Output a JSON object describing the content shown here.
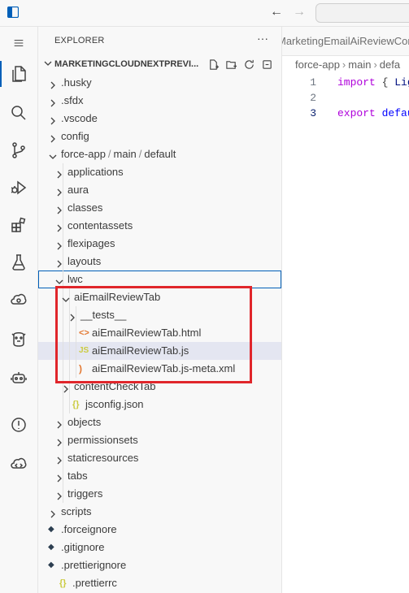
{
  "titlebar": {
    "nav_back": "←",
    "nav_forward": "→"
  },
  "activitybar": {
    "items": [
      "explorer-icon",
      "search-icon",
      "source-control-icon",
      "run-debug-icon",
      "extensions-icon",
      "testing-icon",
      "salesforce-org-icon",
      "agent-icon",
      "robot-icon",
      "info-icon",
      "salesforce-cloud-icon"
    ]
  },
  "explorer": {
    "title": "EXPLORER",
    "more": "···",
    "section_title": "MARKETINGCLOUDNEXTPREVI...",
    "tree": [
      {
        "label": ".husky",
        "type": "folder",
        "depth": 0
      },
      {
        "label": ".sfdx",
        "type": "folder",
        "depth": 0
      },
      {
        "label": ".vscode",
        "type": "folder",
        "depth": 0
      },
      {
        "label": "config",
        "type": "folder",
        "depth": 0
      },
      {
        "label": "force-app",
        "sep1": "/",
        "label2": "main",
        "sep2": "/",
        "label3": "default",
        "type": "folder-open",
        "depth": 0
      },
      {
        "label": "applications",
        "type": "folder",
        "depth": 1
      },
      {
        "label": "aura",
        "type": "folder",
        "depth": 1
      },
      {
        "label": "classes",
        "type": "folder",
        "depth": 1
      },
      {
        "label": "contentassets",
        "type": "folder",
        "depth": 1
      },
      {
        "label": "flexipages",
        "type": "folder",
        "depth": 1
      },
      {
        "label": "layouts",
        "type": "folder",
        "depth": 1
      },
      {
        "label": "lwc",
        "type": "folder-open",
        "depth": 1
      },
      {
        "label": "aiEmailReviewTab",
        "type": "folder-open",
        "depth": 2
      },
      {
        "label": "__tests__",
        "type": "folder",
        "depth": 3
      },
      {
        "label": "aiEmailReviewTab.html",
        "type": "html",
        "icon": "<>",
        "depth": 3
      },
      {
        "label": "aiEmailReviewTab.js",
        "type": "js",
        "icon": "JS",
        "depth": 3
      },
      {
        "label": "aiEmailReviewTab.js-meta.xml",
        "type": "xml",
        "icon": "rss",
        "depth": 3
      },
      {
        "label": "contentCheckTab",
        "type": "folder",
        "depth": 2
      },
      {
        "label": "jsconfig.json",
        "type": "json",
        "icon": "{}",
        "depth": 2
      },
      {
        "label": "objects",
        "type": "folder",
        "depth": 1
      },
      {
        "label": "permissionsets",
        "type": "folder",
        "depth": 1
      },
      {
        "label": "staticresources",
        "type": "folder",
        "depth": 1
      },
      {
        "label": "tabs",
        "type": "folder",
        "depth": 1
      },
      {
        "label": "triggers",
        "type": "folder",
        "depth": 1
      },
      {
        "label": "scripts",
        "type": "folder",
        "depth": 0
      },
      {
        "label": ".forceignore",
        "type": "sf",
        "depth": 0
      },
      {
        "label": ".gitignore",
        "type": "sf",
        "depth": 0
      },
      {
        "label": ".prettierignore",
        "type": "sf",
        "depth": 0
      },
      {
        "label": ".prettierrc",
        "type": "json",
        "icon": "{}",
        "depth": 0
      }
    ]
  },
  "editor": {
    "tab_label": "MarketingEmailAiReviewContr",
    "breadcrumbs": {
      "a": "force-app",
      "b": "main",
      "c": "defa"
    },
    "lines": [
      {
        "num": "1",
        "kw": "import",
        "rest": " { ",
        "id": "Lig"
      },
      {
        "num": "2",
        "kw": "",
        "rest": "",
        "id": ""
      },
      {
        "num": "3",
        "kw": "export",
        "rest": " defau",
        "id": ""
      }
    ]
  },
  "colors": {
    "accent": "#005fb8",
    "highlight_box": "#e0262b",
    "selection": "#e4e6f1"
  }
}
